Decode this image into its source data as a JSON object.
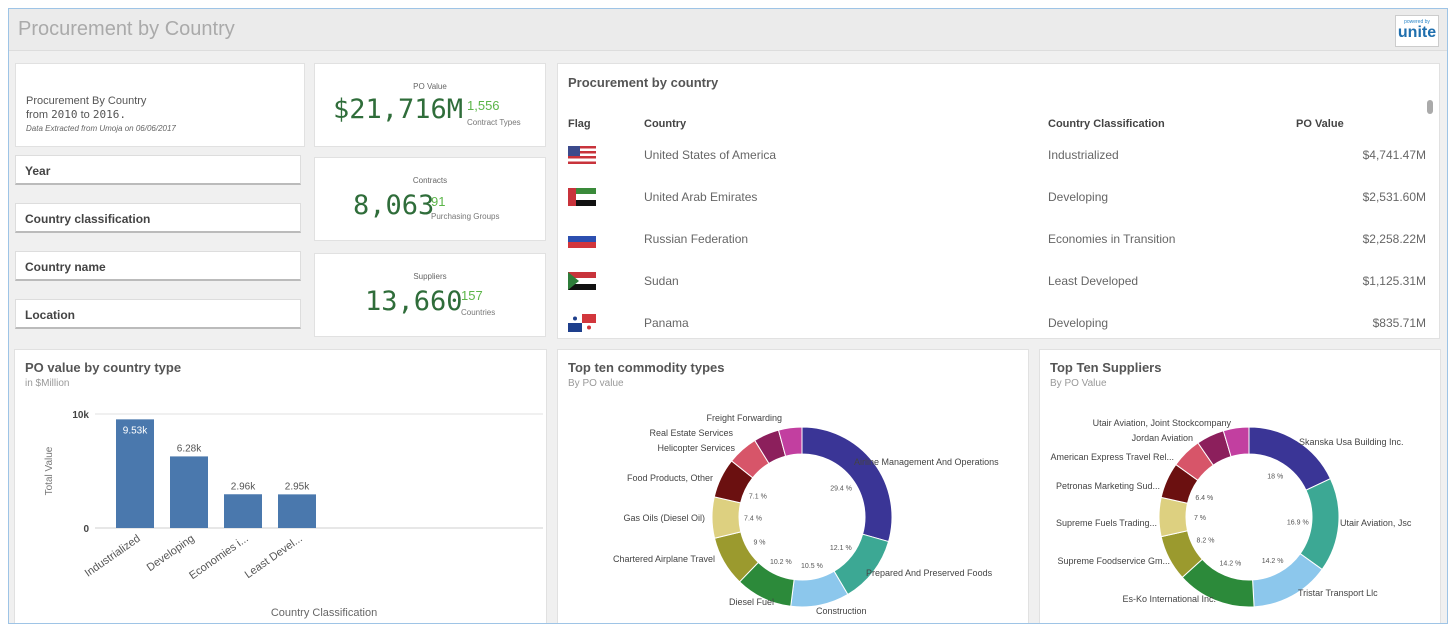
{
  "app": {
    "title": "Procurement by Country",
    "logo_small": "powered by",
    "logo_main": "unite"
  },
  "intro": {
    "line1": "Procurement By Country",
    "line2_prefix": "from ",
    "year_from": "2010",
    "line2_mid": " to ",
    "year_to": "2016.",
    "line3": "Data Extracted from Umoja on 06/06/2017"
  },
  "filters": {
    "year": "Year",
    "country_classification": "Country classification",
    "country_name": "Country name",
    "location": "Location"
  },
  "kpis": [
    {
      "label": "PO Value",
      "big": "$21,716M",
      "num": "1,556",
      "sub": "Contract Types"
    },
    {
      "label": "Contracts",
      "big": "8,063",
      "num": "91",
      "sub": "Purchasing Groups"
    },
    {
      "label": "Suppliers",
      "big": "13,660",
      "num": "157",
      "sub": "Countries"
    }
  ],
  "table": {
    "title": "Procurement by country",
    "headers": {
      "flag": "Flag",
      "country": "Country",
      "classification": "Country Classification",
      "value": "PO Value"
    },
    "rows": [
      {
        "flag": "us-flag",
        "country": "United States of America",
        "classification": "Industrialized",
        "value": "$4,741.47M"
      },
      {
        "flag": "uae-flag",
        "country": "United Arab Emirates",
        "classification": "Developing",
        "value": "$2,531.60M"
      },
      {
        "flag": "russia-flag",
        "country": "Russian Federation",
        "classification": "Economies in Transition",
        "value": "$2,258.22M"
      },
      {
        "flag": "sudan-flag",
        "country": "Sudan",
        "classification": "Least Developed",
        "value": "$1,125.31M"
      },
      {
        "flag": "panama-flag",
        "country": "Panama",
        "classification": "Developing",
        "value": "$835.71M"
      }
    ]
  },
  "chart_data": [
    {
      "type": "bar",
      "title": "PO value by country type",
      "subtitle": "in $Million",
      "xlabel": "Country Classification",
      "ylabel": "Total Value",
      "categories": [
        "Industrialized",
        "Developing",
        "Economies i...",
        "Least Devel..."
      ],
      "values": [
        9530,
        6280,
        2960,
        2950
      ],
      "value_labels": [
        "9.53k",
        "6.28k",
        "2.96k",
        "2.95k"
      ],
      "y_ticks": [
        "0",
        "10k"
      ],
      "ylim": [
        0,
        10000
      ],
      "color": "#4a78ad"
    },
    {
      "type": "pie",
      "title": "Top ten commodity types",
      "subtitle": "By PO value",
      "categories": [
        "Airline Management And Operations",
        "Prepared And Preserved Foods",
        "Construction",
        "Diesel Fuel",
        "Chartered Airplane Travel",
        "Gas Oils (Diesel Oil)",
        "Food Products, Other",
        "Helicopter Services",
        "Real Estate Services",
        "Freight Forwarding"
      ],
      "values": [
        29.4,
        12.1,
        10.5,
        10.2,
        9,
        7.4,
        7.1,
        5.5,
        4.6,
        4.2
      ],
      "pct_labels": [
        "29.4 %",
        "12.1 %",
        "10.5 %",
        "10.2 %",
        "9 %",
        "7.4 %",
        "7.1 %",
        "",
        "",
        ""
      ],
      "colors": [
        "#3a3596",
        "#3ca894",
        "#8cc7ec",
        "#2c8a3a",
        "#9b9a2e",
        "#ddd080",
        "#6b1010",
        "#d75569",
        "#8c1f5c",
        "#c23fa0"
      ]
    },
    {
      "type": "pie",
      "title": "Top Ten Suppliers",
      "subtitle": "By PO Value",
      "categories": [
        "Skanska Usa Building Inc.",
        "Utair Aviation, Jsc",
        "Tristar Transport Llc",
        "Es-Ko International Inc.",
        "Supreme Foodservice Gm...",
        "Supreme Fuels Trading...",
        "Petronas Marketing Sud...",
        "American Express Travel Rel...",
        "Jordan Aviation",
        "Utair Aviation, Joint Stockcompany"
      ],
      "values": [
        18,
        16.9,
        14.2,
        14.2,
        8.2,
        7,
        6.4,
        5.5,
        5,
        4.6
      ],
      "pct_labels": [
        "18 %",
        "16.9 %",
        "14.2 %",
        "14.2 %",
        "8.2 %",
        "7 %",
        "6.4 %",
        "",
        "",
        ""
      ],
      "colors": [
        "#3a3596",
        "#3ca894",
        "#8cc7ec",
        "#2c8a3a",
        "#9b9a2e",
        "#ddd080",
        "#6b1010",
        "#d75569",
        "#8c1f5c",
        "#c23fa0"
      ]
    }
  ]
}
